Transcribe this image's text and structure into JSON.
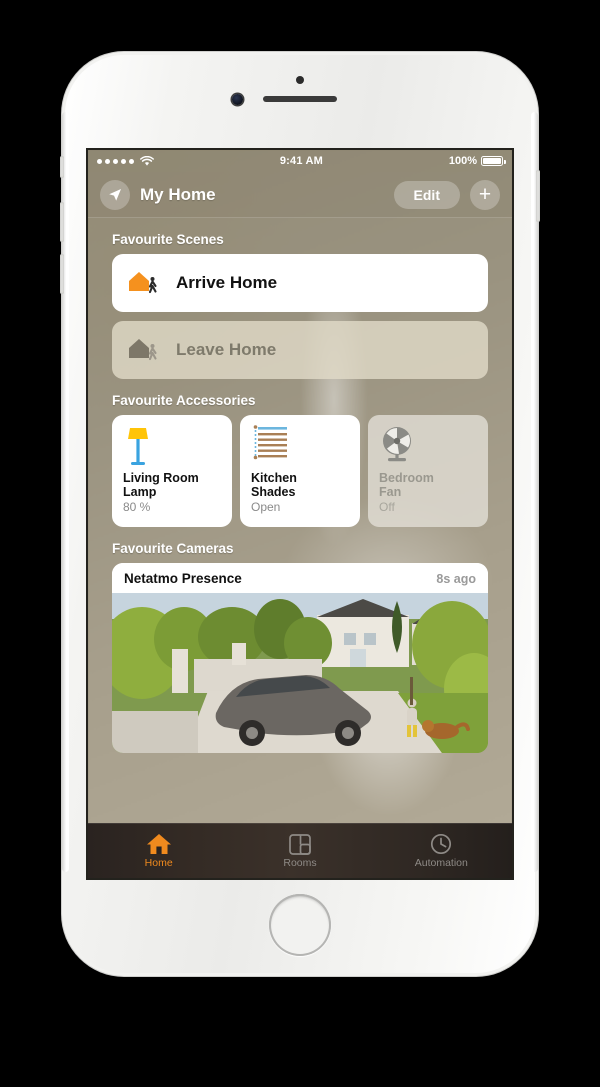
{
  "device": {
    "name": "iPhone",
    "color": "white"
  },
  "status_bar": {
    "signal_dots": 5,
    "wifi": "wifi-icon",
    "time": "9:41 AM",
    "battery_percent": "100%",
    "battery_level": 100
  },
  "nav_bar": {
    "location_icon": "location-arrow-icon",
    "title": "My Home",
    "edit_label": "Edit",
    "add_label": "+"
  },
  "sections": {
    "scenes_title": "Favourite Scenes",
    "accessories_title": "Favourite Accessories",
    "cameras_title": "Favourite Cameras"
  },
  "scenes": [
    {
      "label": "Arrive Home",
      "state": "on",
      "icon": "house-arrive-icon",
      "house_color": "#f5911e"
    },
    {
      "label": "Leave Home",
      "state": "off",
      "icon": "house-leave-icon",
      "house_color": "#7d7768"
    }
  ],
  "accessories": [
    {
      "name": "Living Room Lamp",
      "name_line1": "Living Room",
      "name_line2": "Lamp",
      "state": "80 %",
      "power": "on",
      "icon": "floor-lamp-icon",
      "icon_colors": {
        "shade": "#ffc408",
        "stand": "#3aa3e0"
      }
    },
    {
      "name": "Kitchen Shades",
      "name_line1": "Kitchen",
      "name_line2": "Shades",
      "state": "Open",
      "power": "on",
      "icon": "window-blinds-icon",
      "icon_colors": {
        "slats": "#a97f55",
        "rail": "#6cb6de"
      }
    },
    {
      "name": "Bedroom Fan",
      "name_line1": "Bedroom",
      "name_line2": "Fan",
      "state": "Off",
      "power": "off",
      "icon": "fan-icon",
      "icon_colors": {
        "body": "#8b8b86"
      }
    }
  ],
  "camera": {
    "name": "Netatmo Presence",
    "timestamp": "8s ago",
    "scene_description": "driveway with parked car, house, garden, person walking a dog"
  },
  "tabs": [
    {
      "label": "Home",
      "icon": "home-icon",
      "active": true
    },
    {
      "label": "Rooms",
      "icon": "rooms-grid-icon",
      "active": false
    },
    {
      "label": "Automation",
      "icon": "clock-icon",
      "active": false
    }
  ],
  "colors": {
    "accent": "#f08a1e",
    "wallpaper": "#a79f8c",
    "tabbar": "#332a24",
    "card_on": "#ffffff",
    "card_off": "#e2dfd6"
  }
}
